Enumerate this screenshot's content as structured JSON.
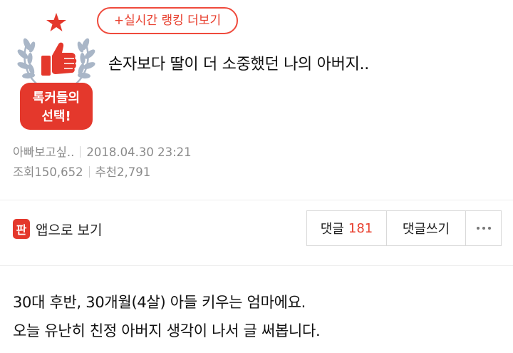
{
  "badge": {
    "line1": "톡커들의",
    "line2": "선택!",
    "colors": {
      "red": "#e4382c",
      "wreath": "#a9b6c7",
      "star": "#e4382c"
    },
    "icons": [
      "star-icon",
      "laurel-wreath-icon",
      "thumbs-up-icon"
    ]
  },
  "header": {
    "ranking_button": "+실시간 랭킹 더보기",
    "title": "손자보다 딸이 더 소중했던 나의 아버지.."
  },
  "meta": {
    "author": "아빠보고싶..",
    "datetime": "2018.04.30 23:21",
    "views_label": "조회",
    "views": "150,652",
    "likes_label": "추천",
    "likes": "2,791"
  },
  "actions": {
    "app_logo": "판",
    "app_view": "앱으로 보기",
    "comments_label": "댓글",
    "comments_count": "181",
    "write_comment": "댓글쓰기",
    "more_icon": "more-dots-icon"
  },
  "content": {
    "line1": "30대 후반, 30개월(4살) 아들 키우는 엄마에요.",
    "line2": "오늘 유난히 친정 아버지 생각이 나서 글 써봅니다."
  },
  "colors": {
    "accent": "#e8402f",
    "meta_text": "#8a8a8a",
    "border": "#d9d9d9"
  }
}
